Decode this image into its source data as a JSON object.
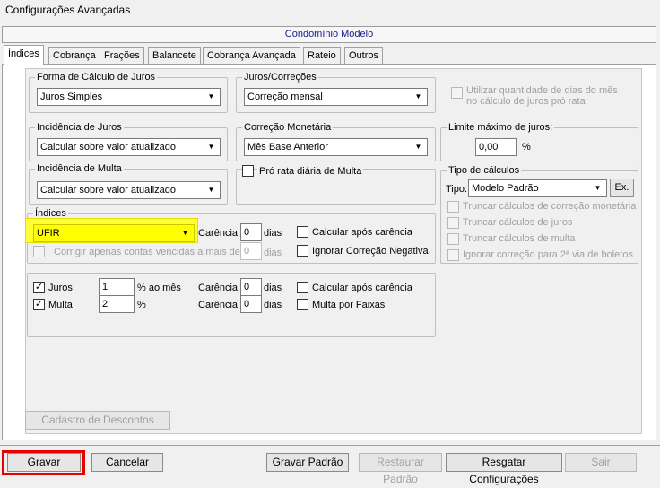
{
  "window": {
    "title": "Configurações Avançadas"
  },
  "header": {
    "condominium": "Condomínio Modelo"
  },
  "tabs": [
    {
      "label": "Índices",
      "active": true
    },
    {
      "label": "Cobrança"
    },
    {
      "label": "Frações"
    },
    {
      "label": "Balancete"
    },
    {
      "label": "Cobrança Avançada"
    },
    {
      "label": "Rateio"
    },
    {
      "label": "Outros"
    }
  ],
  "forma_calculo": {
    "label": "Forma de Cálculo de Juros",
    "value": "Juros Simples"
  },
  "juros_correcoes": {
    "label": "Juros/Correções",
    "value": "Correção mensal"
  },
  "utilizar_dias": {
    "line1": "Utilizar quantidade de dias do mês",
    "line2": "no cálculo de juros pró rata"
  },
  "incidencia_juros": {
    "label": "Incidência de Juros",
    "value": "Calcular sobre valor atualizado"
  },
  "correcao_monetaria": {
    "label": "Correção Monetária",
    "value": "Mês Base Anterior"
  },
  "limite_juros": {
    "label": "Limite máximo de juros:",
    "value": "0,00",
    "unit": "%"
  },
  "incidencia_multa": {
    "label": "Incidência de Multa",
    "value": "Calcular sobre valor atualizado"
  },
  "pro_rata": {
    "label": "Pró rata diária de Multa"
  },
  "tipo_calculos": {
    "label": "Tipo de cálculos",
    "tipo_label": "Tipo:",
    "value": "Modelo Padrão",
    "ex_button": "Ex.",
    "options": [
      "Truncar cálculos de correção monetária",
      "Truncar cálculos de juros",
      "Truncar cálculos de multa",
      "Ignorar correção para 2ª via de boletos"
    ]
  },
  "indices": {
    "label": "Índices",
    "value": "UFIR",
    "carencia_label": "Carência:",
    "carencia_value": "0",
    "dias_label": "dias",
    "calcular_apos": "Calcular após carência",
    "corrigir_label": "Corrigir apenas contas vencidas a mais de",
    "corrigir_value": "0",
    "corrigir_dias": "dias",
    "ignorar_negativa": "Ignorar Correção Negativa"
  },
  "juros_multa": {
    "juros_label": "Juros",
    "juros_value": "1",
    "juros_unit": "% ao mês",
    "multa_label": "Multa",
    "multa_value": "2",
    "multa_unit": "%",
    "carencia_label": "Carência:",
    "carencia_juros": "0",
    "carencia_multa": "0",
    "dias_label": "dias",
    "calcular_apos": "Calcular após carência",
    "multa_faixas": "Multa por Faixas"
  },
  "cadastro_descontos": "Cadastro de Descontos",
  "footer": {
    "gravar": "Gravar",
    "cancelar": "Cancelar",
    "gravar_padrao": "Gravar Padrão",
    "restaurar_padrao": "Restaurar Padrão",
    "resgatar": "Resgatar Configurações",
    "sair": "Sair"
  }
}
